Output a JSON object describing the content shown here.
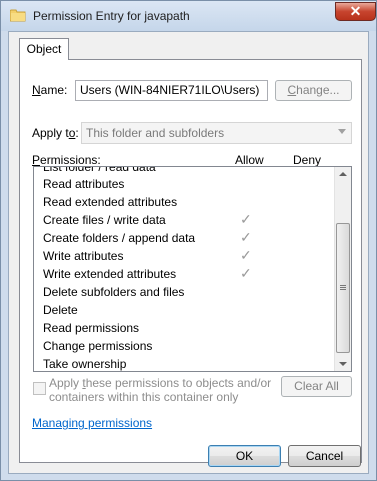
{
  "window": {
    "title": "Permission Entry for javapath",
    "close_label": "✕"
  },
  "tabs": [
    {
      "label": "Object"
    }
  ],
  "name": {
    "label_prefix": "",
    "label_underline": "N",
    "label_rest": "ame:",
    "value": "Users (WIN-84NIER71ILO\\Users)",
    "change_label_u": "C",
    "change_label_rest": "hange..."
  },
  "apply_to": {
    "label_prefix": "Apply t",
    "label_underline": "o",
    "label_rest": ":",
    "value": "This folder and subfolders"
  },
  "permissions": {
    "label_underline": "P",
    "label_rest": "ermissions:",
    "col_allow": "Allow",
    "col_deny": "Deny",
    "partial_top_item": "List folder / read data",
    "items": [
      {
        "label": "Read attributes",
        "allow": false
      },
      {
        "label": "Read extended attributes",
        "allow": false
      },
      {
        "label": "Create files / write data",
        "allow": true
      },
      {
        "label": "Create folders / append data",
        "allow": true
      },
      {
        "label": "Write attributes",
        "allow": true
      },
      {
        "label": "Write extended attributes",
        "allow": true
      },
      {
        "label": "Delete subfolders and files",
        "allow": false
      },
      {
        "label": "Delete",
        "allow": false
      },
      {
        "label": "Read permissions",
        "allow": false
      },
      {
        "label": "Change permissions",
        "allow": false
      },
      {
        "label": "Take ownership",
        "allow": false
      }
    ],
    "check_glyph": "✓"
  },
  "apply_inherit": {
    "line1_prefix": "Apply ",
    "line1_u": "t",
    "line1_rest": "hese permissions to objects and/or",
    "line2": "containers within this container only",
    "checked": false
  },
  "clear_all_label": "Clear All",
  "managing_link": "Managing permissions",
  "buttons": {
    "ok": "OK",
    "cancel": "Cancel"
  }
}
